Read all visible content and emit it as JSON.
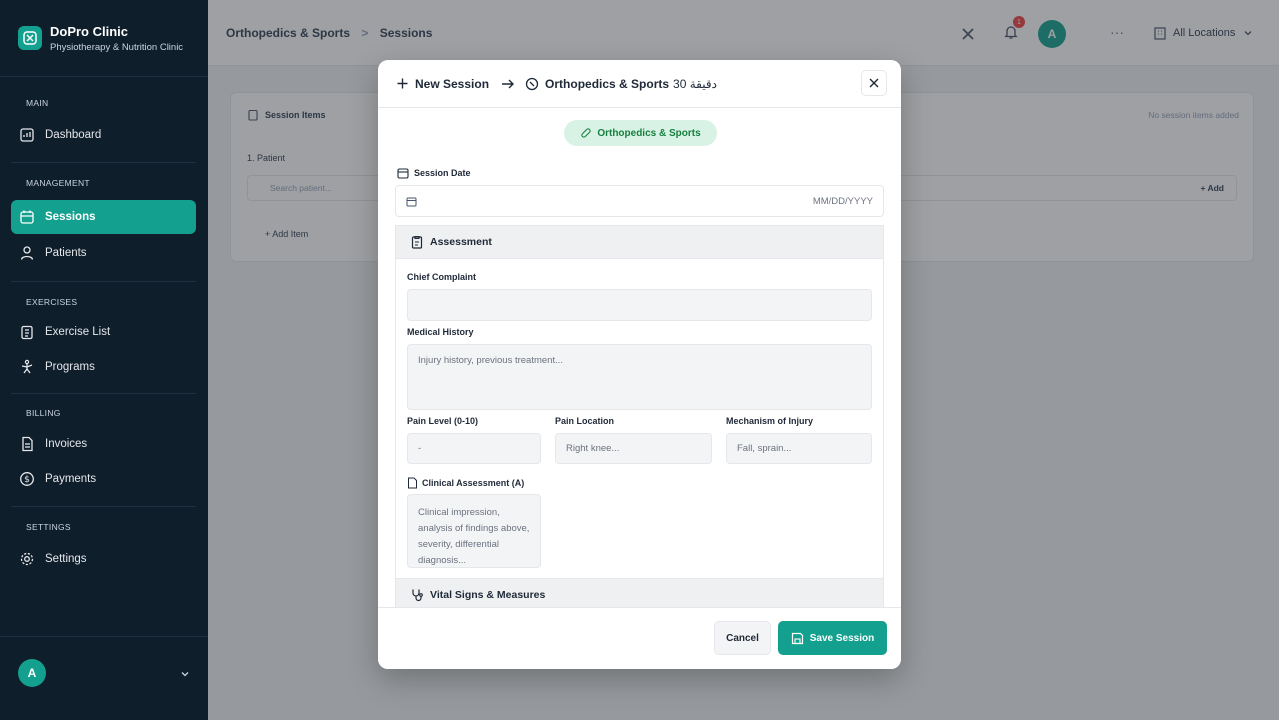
{
  "app": {
    "name": "DoPro Clinic",
    "subtitle": "Physiotherapy & Nutrition Clinic"
  },
  "sidebar": {
    "sections": [
      "MAIN",
      "MANAGEMENT",
      "EXERCISES",
      "BILLING",
      "SETTINGS"
    ],
    "items": [
      {
        "label": "Dashboard",
        "icon": "dashboard-icon"
      },
      {
        "label": "Sessions",
        "icon": "calendar-icon",
        "active": true
      },
      {
        "label": "Patients",
        "icon": "user-icon"
      },
      {
        "label": "Exercise List",
        "icon": "clipboard-icon"
      },
      {
        "label": "Programs",
        "icon": "programs-icon"
      },
      {
        "label": "Invoices",
        "icon": "invoice-icon"
      },
      {
        "label": "Payments",
        "icon": "dollar-icon"
      },
      {
        "label": "Settings",
        "icon": "gear-icon"
      }
    ],
    "user_initial": "A"
  },
  "topbar": {
    "breadcrumb": [
      "Orthopedics & Sports",
      "Sessions"
    ],
    "notification_count": "1",
    "user_initial": "A",
    "location": "All Locations"
  },
  "background": {
    "card_title": "Session Items",
    "empty_note": "No session items added",
    "patient_label": "1. Patient",
    "search_placeholder": "Search patient...",
    "add_label": "Add",
    "add_item_label": "Add Item"
  },
  "modal": {
    "title": "New Session",
    "specialty": "Orthopedics & Sports",
    "duration": "30 دقيقة",
    "pill_label": "Orthopedics & Sports",
    "session_date_label": "Session Date",
    "session_date_placeholder": "MM/DD/YYYY",
    "assessment_title": "Assessment",
    "chief_complaint_label": "Chief Complaint",
    "chief_complaint_value": "",
    "medical_history_label": "Medical History",
    "medical_history_placeholder": "Injury history, previous treatment...",
    "pain_level_label": "Pain Level (0-10)",
    "pain_level_value": "-",
    "pain_location_label": "Pain Location",
    "pain_location_placeholder": "Right knee...",
    "mechanism_label": "Mechanism of Injury",
    "mechanism_placeholder": "Fall, sprain...",
    "clinical_label": "Clinical Assessment (A)",
    "clinical_placeholder": "Clinical impression, analysis of findings above, severity, differential diagnosis...",
    "vitals_title": "Vital Signs & Measures",
    "cancel_label": "Cancel",
    "save_label": "Save Session"
  },
  "colors": {
    "accent": "#14a08e",
    "sidebar_bg": "#0f1e2b",
    "pill_bg": "#d9f2e6",
    "pill_text": "#15803d"
  }
}
